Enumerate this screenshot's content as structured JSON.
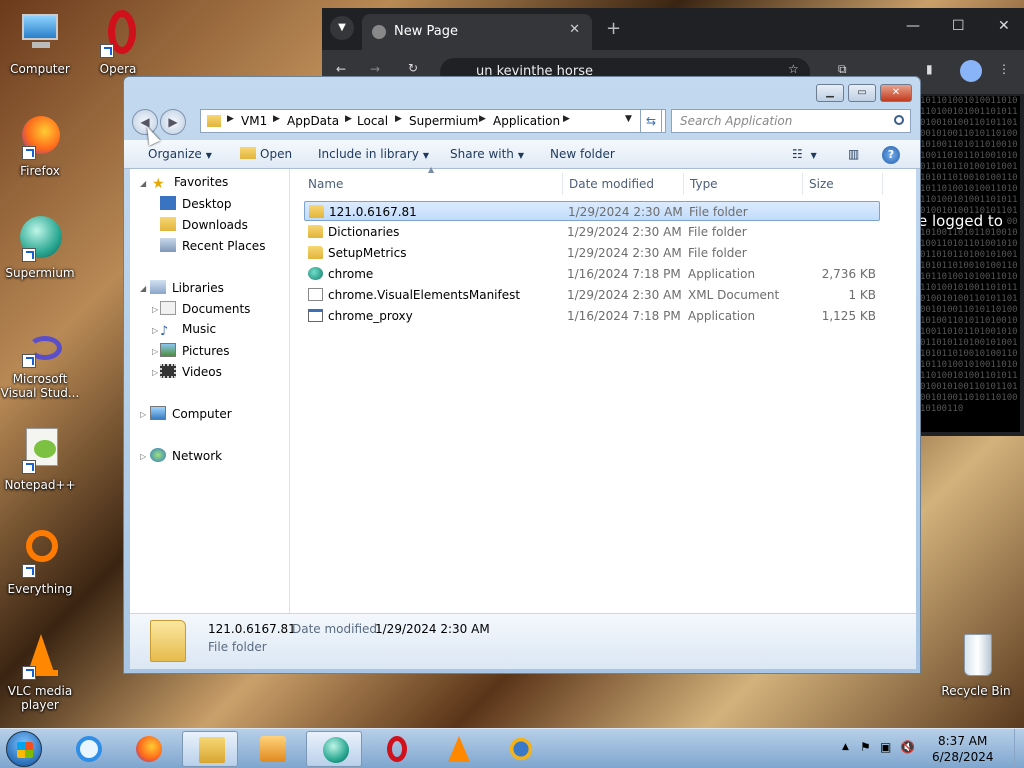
{
  "desktop": {
    "icons": [
      {
        "label": "Computer"
      },
      {
        "label": "Opera"
      },
      {
        "label": "Firefox"
      },
      {
        "label": "Supermium"
      },
      {
        "label": "Microsoft Visual Stud..."
      },
      {
        "label": "Notepad++"
      },
      {
        "label": "Everything"
      },
      {
        "label": "VLC media player"
      },
      {
        "label": "Recycle Bin"
      }
    ]
  },
  "chrome": {
    "tab_title": "New Page",
    "omnibox_text": "un kevinthe horse",
    "page_message": "e logged to",
    "matrix": "10110100101001101011010010100110101101001010011010110100101001101011010010100110101101001010011010110100101001101011010010100110101101001010011010110100101001101011010010100110101101001010011010110100101001101011010010100110101101001010011010110100101001101011010010100110101101001010011010110100101001101011010010100110101101001010011010110100101001101011010010100110101101001010011010110100101001101011010010100110101101001010011010110100101001101011010010100110101101001010011010110100101001101011010010100110"
  },
  "explorer": {
    "breadcrumbs": [
      "VM1",
      "AppData",
      "Local",
      "Supermium",
      "Application"
    ],
    "search_placeholder": "Search Application",
    "commands": {
      "organize": "Organize",
      "open": "Open",
      "include_in_library": "Include in library",
      "share_with": "Share with",
      "new_folder": "New folder"
    },
    "nav": {
      "favorites": "Favorites",
      "desktop": "Desktop",
      "downloads": "Downloads",
      "recent_places": "Recent Places",
      "libraries": "Libraries",
      "documents": "Documents",
      "music": "Music",
      "pictures": "Pictures",
      "videos": "Videos",
      "computer": "Computer",
      "network": "Network"
    },
    "columns": {
      "name": "Name",
      "date": "Date modified",
      "type": "Type",
      "size": "Size"
    },
    "files": [
      {
        "name": "121.0.6167.81",
        "date": "1/29/2024 2:30 AM",
        "type": "File folder",
        "size": "",
        "icon": "folder-icon"
      },
      {
        "name": "Dictionaries",
        "date": "1/29/2024 2:30 AM",
        "type": "File folder",
        "size": "",
        "icon": "folder-icon"
      },
      {
        "name": "SetupMetrics",
        "date": "1/29/2024 2:30 AM",
        "type": "File folder",
        "size": "",
        "icon": "folder-icon"
      },
      {
        "name": "chrome",
        "date": "1/16/2024 7:18 PM",
        "type": "Application",
        "size": "2,736 KB",
        "icon": "supermium-app-icon"
      },
      {
        "name": "chrome.VisualElementsManifest",
        "date": "1/29/2024 2:30 AM",
        "type": "XML Document",
        "size": "1 KB",
        "icon": "xml-file-icon"
      },
      {
        "name": "chrome_proxy",
        "date": "1/16/2024 7:18 PM",
        "type": "Application",
        "size": "1,125 KB",
        "icon": "exe-file-icon"
      }
    ],
    "details": {
      "name": "121.0.6167.81",
      "date_label": "Date modified:",
      "date": "1/29/2024 2:30 AM",
      "type": "File folder"
    }
  },
  "taskbar": {
    "time": "8:37 AM",
    "date": "6/28/2024"
  },
  "colors": {
    "selection": "#c1dcfc",
    "folder": "#e2b43c",
    "chrome_bg": "#202124"
  }
}
